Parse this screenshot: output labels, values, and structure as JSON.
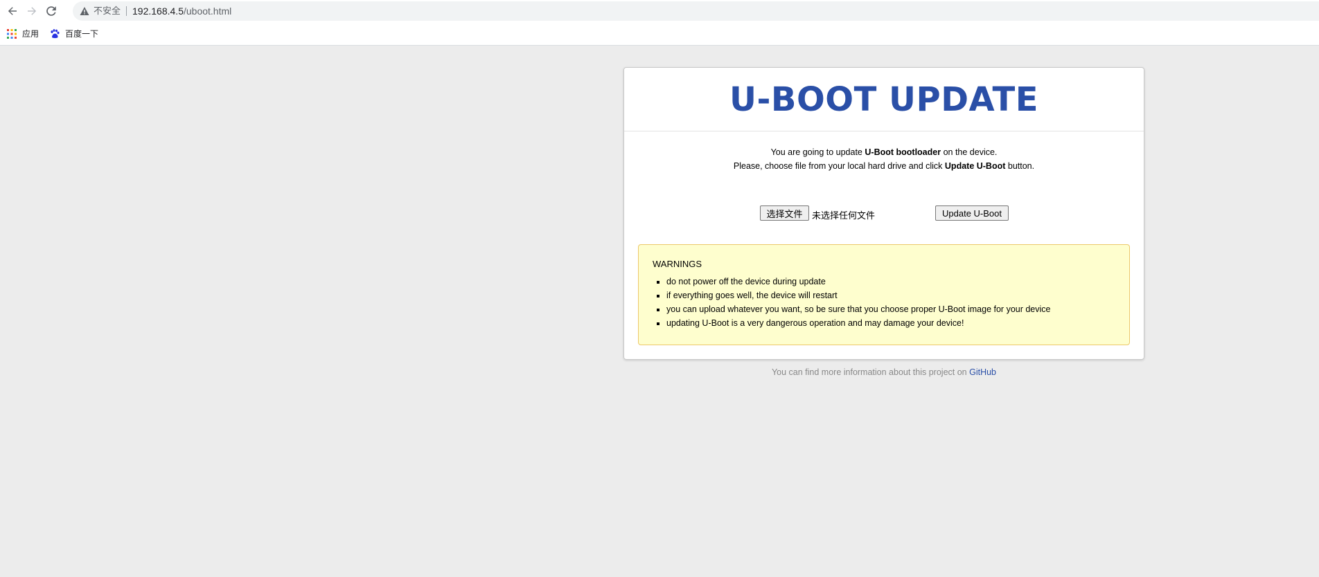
{
  "browser": {
    "security_label": "不安全",
    "url_host": "192.168.4.5",
    "url_path": "/uboot.html",
    "bookmarks": [
      {
        "label": "应用",
        "icon": "apps-grid-icon"
      },
      {
        "label": "百度一下",
        "icon": "baidu-paw-icon"
      }
    ]
  },
  "page": {
    "title": "U-BOOT UPDATE",
    "intro_line1_pre": "You are going to update ",
    "intro_line1_bold": "U-Boot bootloader",
    "intro_line1_post": " on the device.",
    "intro_line2_pre": "Please, choose file from your local hard drive and click ",
    "intro_line2_bold": "Update U-Boot",
    "intro_line2_post": " button.",
    "file_button_label": "选择文件",
    "file_status": "未选择任何文件",
    "update_button_label": "Update U-Boot",
    "warnings_title": "WARNINGS",
    "warnings": [
      "do not power off the device during update",
      "if everything goes well, the device will restart",
      "you can upload whatever you want, so be sure that you choose proper U-Boot image for your device",
      "updating U-Boot is a very dangerous operation and may damage your device!"
    ],
    "footer_text": "You can find more information about this project on ",
    "footer_link": "GitHub"
  },
  "colors": {
    "title": "#2a4fa7",
    "warning_bg": "#fefece",
    "warning_border": "#ecc86a",
    "page_bg": "#ececec"
  }
}
